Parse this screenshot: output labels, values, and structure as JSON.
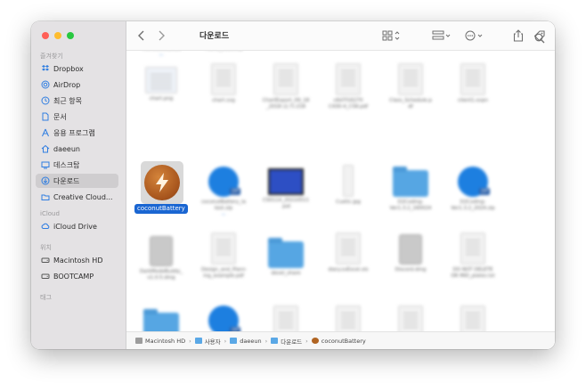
{
  "window": {
    "title": "다운로드"
  },
  "sidebar": {
    "sections": [
      {
        "title": "즐겨찾기",
        "items": [
          {
            "label": "Dropbox",
            "icon": "dropbox-icon"
          },
          {
            "label": "AirDrop",
            "icon": "airdrop-icon"
          },
          {
            "label": "최근 항목",
            "icon": "clock-icon"
          },
          {
            "label": "문서",
            "icon": "document-icon"
          },
          {
            "label": "응용 프로그램",
            "icon": "applications-icon"
          },
          {
            "label": "daeeun",
            "icon": "home-icon"
          },
          {
            "label": "데스크탑",
            "icon": "desktop-icon"
          },
          {
            "label": "다운로드",
            "icon": "download-icon",
            "active": true
          },
          {
            "label": "Creative Cloud...",
            "icon": "folder-icon"
          }
        ]
      },
      {
        "title": "iCloud",
        "items": [
          {
            "label": "iCloud Drive",
            "icon": "cloud-icon"
          }
        ]
      },
      {
        "title": "위치",
        "items": [
          {
            "label": "Macintosh HD",
            "icon": "disk-icon"
          },
          {
            "label": "BOOTCAMP",
            "icon": "disk-icon"
          }
        ]
      },
      {
        "title": "태그",
        "items": []
      }
    ]
  },
  "toolbar": {
    "back_icon": "chevron-left-icon",
    "forward_icon": "chevron-right-icon",
    "view_icon": "grid-icon",
    "group_icon": "group-icon",
    "action_icon": "ellipsis-circle-icon",
    "share_icon": "share-icon",
    "tag_icon": "tag-icon",
    "search_icon": "search-icon"
  },
  "files": {
    "selected": {
      "name": "coconutBattery"
    }
  },
  "pathbar": {
    "crumbs": [
      {
        "label": "Macintosh HD",
        "type": "hd"
      },
      {
        "label": "사용자",
        "type": "folder"
      },
      {
        "label": "daeeun",
        "type": "folder"
      },
      {
        "label": "다운로드",
        "type": "folder"
      },
      {
        "label": "coconutBattery",
        "type": "app"
      }
    ],
    "separator": "›"
  },
  "colors": {
    "sidebar_bg": "#e4e2e4",
    "selection": "#1a66d2",
    "folder": "#56a6e3"
  }
}
